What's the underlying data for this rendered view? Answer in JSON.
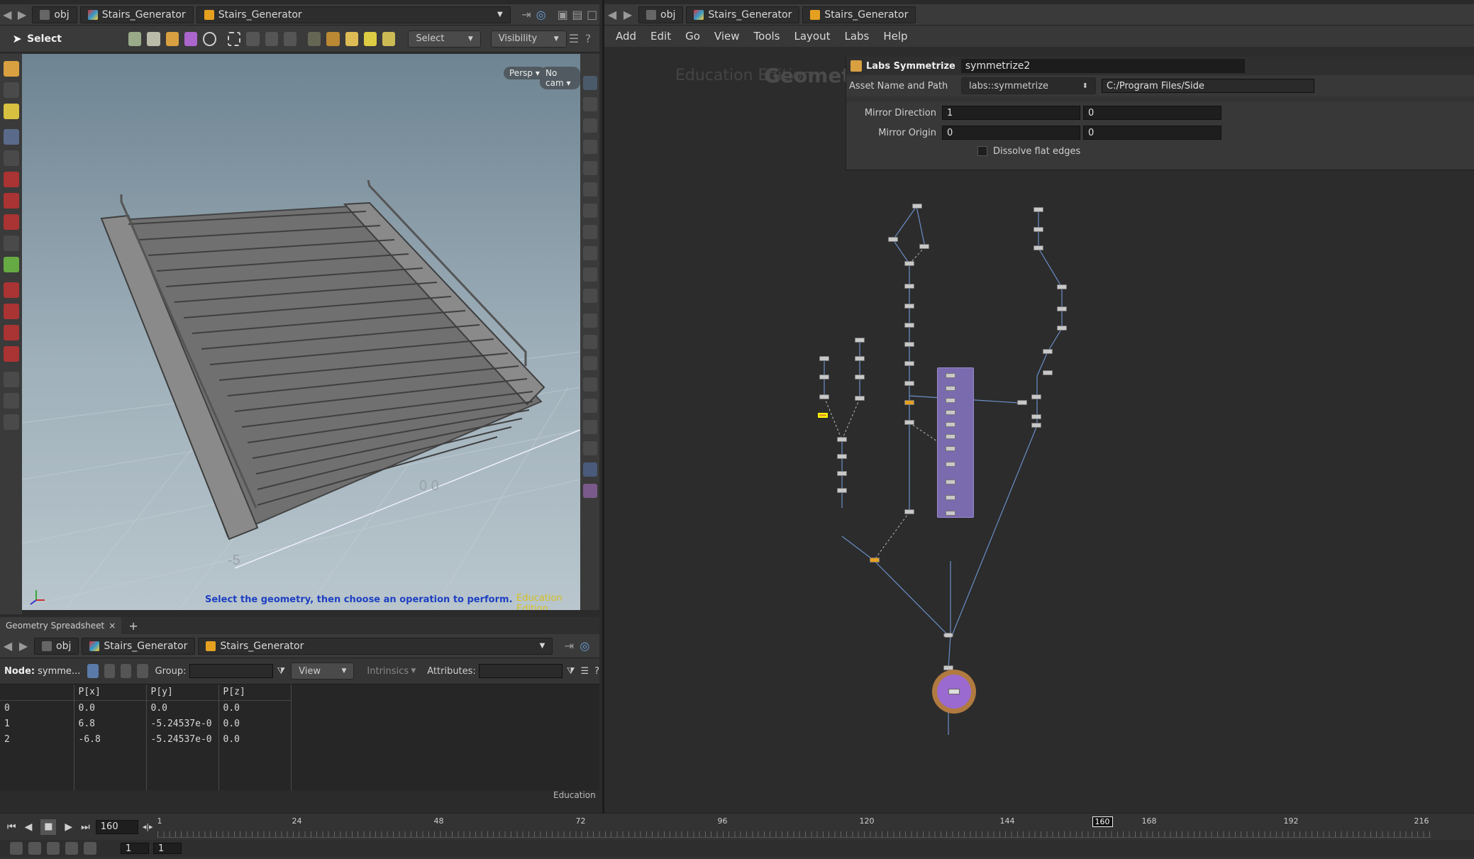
{
  "left_pane": {
    "path": {
      "root": "obj",
      "net": "Stairs_Generator",
      "node": "Stairs_Generator"
    },
    "toolbar": {
      "select_label": "Select",
      "mode_dropdown": "Select",
      "visibility_dropdown": "Visibility"
    },
    "viewport": {
      "persp": "Persp",
      "cam": "No cam",
      "status": "Select the geometry, then choose an operation to perform.",
      "watermark": "Education Edition",
      "grid_labels": [
        "-5",
        "0 0"
      ]
    }
  },
  "spreadsheet": {
    "tab": "Geometry Spreadsheet",
    "add": "+",
    "path": {
      "root": "obj",
      "net": "Stairs_Generator",
      "node": "Stairs_Generator"
    },
    "node_label": "Node:",
    "node_name": "symme...",
    "group_label": "Group:",
    "view": "View",
    "intrinsics": "Intrinsics",
    "attributes_label": "Attributes:",
    "headers": [
      "",
      "P[x]",
      "P[y]",
      "P[z]"
    ],
    "rows": [
      [
        "0",
        "0.0",
        "0.0",
        "0.0"
      ],
      [
        "1",
        "6.8",
        "-5.24537e-0",
        "0.0"
      ],
      [
        "2",
        "-6.8",
        "-5.24537e-0",
        "0.0"
      ]
    ],
    "watermark": "Education"
  },
  "right_pane": {
    "path": {
      "root": "obj",
      "net": "Stairs_Generator",
      "node": "Stairs_Generator"
    },
    "menu": [
      "Add",
      "Edit",
      "Go",
      "View",
      "Tools",
      "Layout",
      "Labs",
      "Help"
    ],
    "watermark": "Education Edition",
    "context": "Geometry",
    "parms": {
      "type": "Labs Symmetrize",
      "name": "symmetrize2",
      "asset_label": "Asset Name and Path",
      "asset_name": "labs::symmetrize",
      "asset_path": "C:/Program Files/Side",
      "mirror_dir_label": "Mirror Direction",
      "mirror_dir": [
        "1",
        "0"
      ],
      "mirror_origin_label": "Mirror Origin",
      "mirror_origin": [
        "0",
        "0"
      ],
      "dissolve_label": "Dissolve flat edges"
    }
  },
  "timeline": {
    "frame": "160",
    "ticks": [
      "1",
      "24",
      "48",
      "72",
      "96",
      "120",
      "144",
      "168",
      "192",
      "216"
    ],
    "current": "160",
    "start": "1",
    "end": "1"
  },
  "colors": {
    "accent": "#e6a020",
    "bg": "#2b2b2b",
    "panel": "#3a3a3a",
    "viewport_top": "#6e8492",
    "viewport_bottom": "#b9c6cd",
    "status_blue": "#1d3fc2",
    "edu_yellow": "#d4c020"
  }
}
